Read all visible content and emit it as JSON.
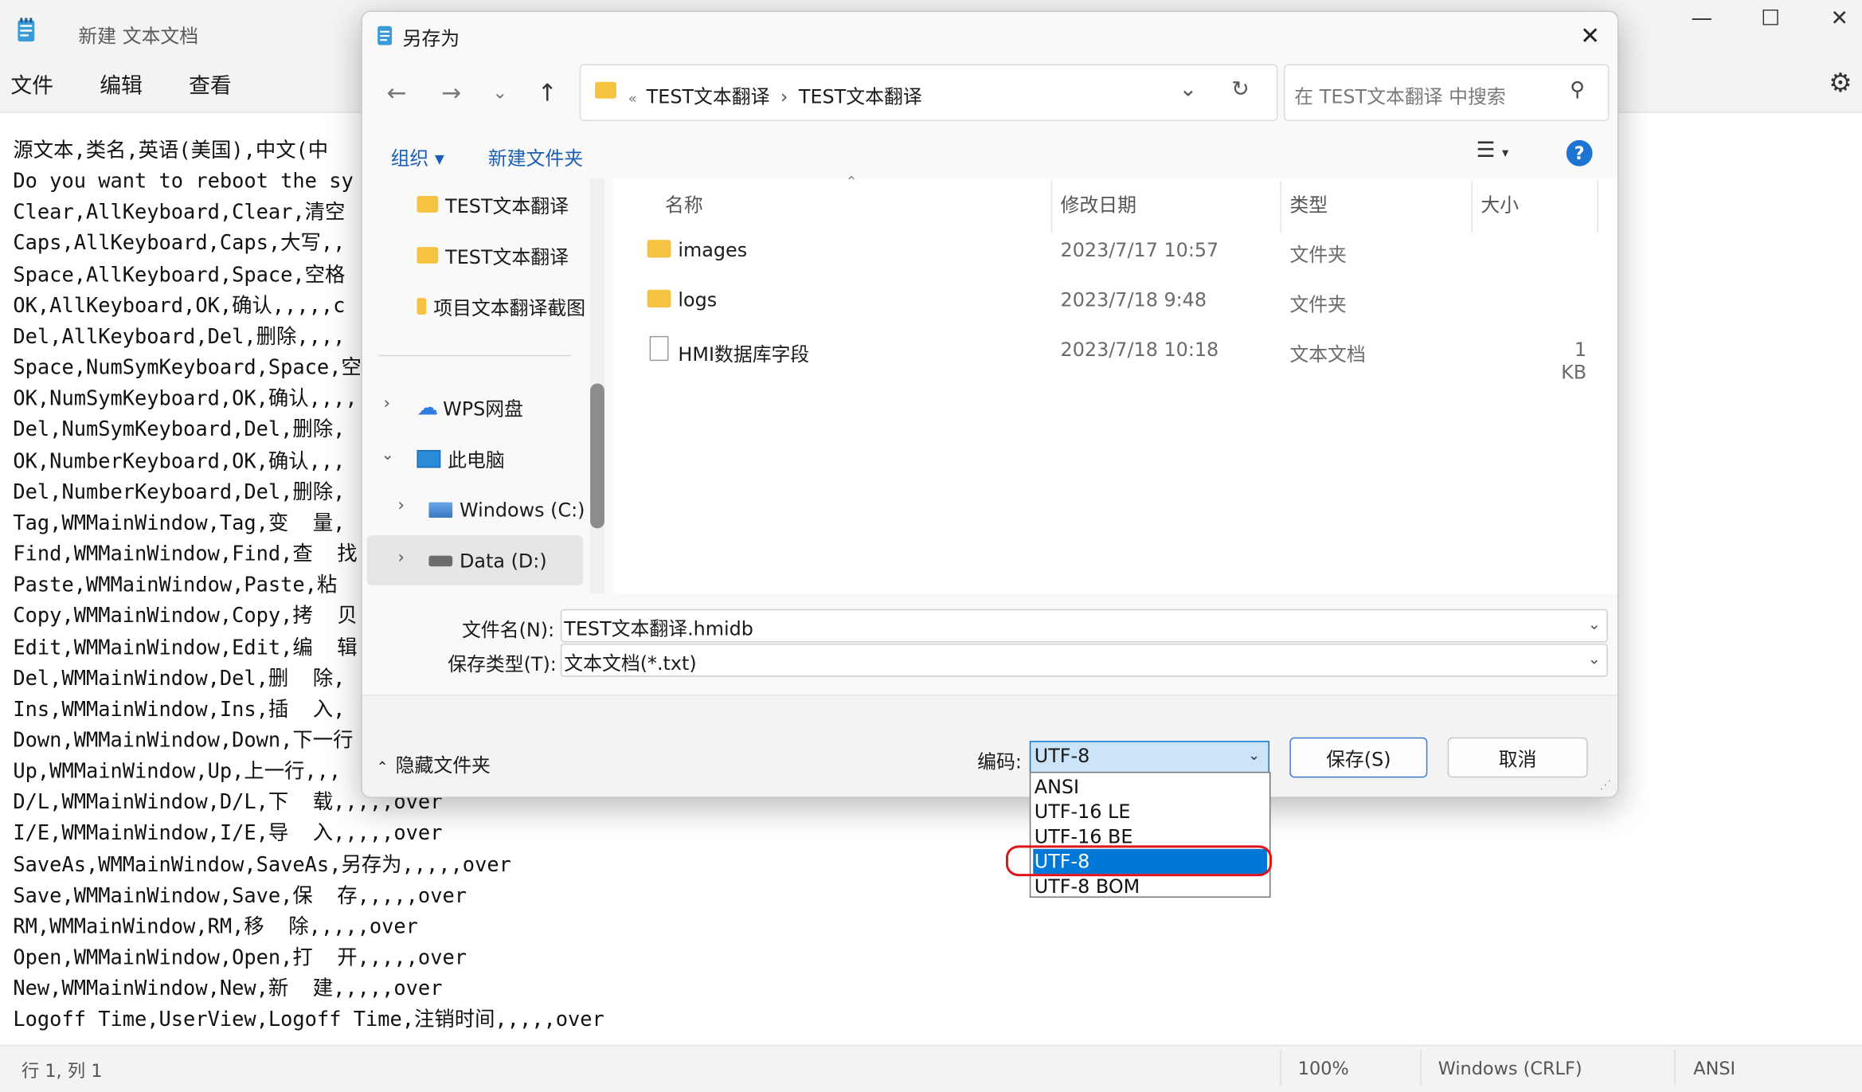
{
  "notepad": {
    "title": "新建 文本文档",
    "menus": [
      "文件",
      "编辑",
      "查看"
    ],
    "lines": [
      "源文本,类名,英语(美国),中文(中",
      "Do you want to reboot the sy",
      "Clear,AllKeyboard,Clear,清空",
      "Caps,AllKeyboard,Caps,大写,,",
      "Space,AllKeyboard,Space,空格",
      "OK,AllKeyboard,OK,确认,,,,,c",
      "Del,AllKeyboard,Del,删除,,,,",
      "Space,NumSymKeyboard,Space,空",
      "OK,NumSymKeyboard,OK,确认,,,,",
      "Del,NumSymKeyboard,Del,删除,",
      "OK,NumberKeyboard,OK,确认,,,",
      "Del,NumberKeyboard,Del,删除,",
      "Tag,WMMainWindow,Tag,变  量,",
      "Find,WMMainWindow,Find,查  找",
      "Paste,WMMainWindow,Paste,粘  ",
      "Copy,WMMainWindow,Copy,拷  贝",
      "Edit,WMMainWindow,Edit,编  辑",
      "Del,WMMainWindow,Del,删  除,",
      "Ins,WMMainWindow,Ins,插  入,",
      "Down,WMMainWindow,Down,下一行",
      "Up,WMMainWindow,Up,上一行,,,",
      "D/L,WMMainWindow,D/L,下  载,,,,,over",
      "I/E,WMMainWindow,I/E,导  入,,,,,over",
      "SaveAs,WMMainWindow,SaveAs,另存为,,,,,over",
      "Save,WMMainWindow,Save,保  存,,,,,over",
      "RM,WMMainWindow,RM,移  除,,,,,over",
      "Open,WMMainWindow,Open,打  开,,,,,over",
      "New,WMMainWindow,New,新  建,,,,,over",
      "Logoff Time,UserView,Logoff Time,注销时间,,,,,over"
    ],
    "status": {
      "position": "行 1, 列 1",
      "zoom": "100%",
      "line_ending": "Windows (CRLF)",
      "encoding": "ANSI"
    }
  },
  "dialog": {
    "title": "另存为",
    "address": {
      "path": [
        "TEST文本翻译",
        "TEST文本翻译"
      ],
      "separator": "›",
      "prefix": "«"
    },
    "search_placeholder": "在 TEST文本翻译 中搜索",
    "commands": {
      "organize": "组织 ▾",
      "new_folder": "新建文件夹"
    },
    "nav": [
      {
        "label": "TEST文本翻译",
        "type": "folder"
      },
      {
        "label": "TEST文本翻译",
        "type": "folder"
      },
      {
        "label": "项目文本翻译截图",
        "type": "folder"
      },
      {
        "label": "WPS网盘",
        "type": "cloud"
      },
      {
        "label": "此电脑",
        "type": "pc"
      },
      {
        "label": "Windows (C:)",
        "type": "drive"
      },
      {
        "label": "Data (D:)",
        "type": "drive"
      }
    ],
    "columns": {
      "name": "名称",
      "date": "修改日期",
      "type": "类型",
      "size": "大小"
    },
    "files": [
      {
        "name": "images",
        "date": "2023/7/17 10:57",
        "type": "文件夹",
        "size": ""
      },
      {
        "name": "logs",
        "date": "2023/7/18 9:48",
        "type": "文件夹",
        "size": ""
      },
      {
        "name": "HMI数据库字段",
        "date": "2023/7/18 10:18",
        "type": "文本文档",
        "size": "1 KB"
      }
    ],
    "filename_label": "文件名(N):",
    "filename_value": "TEST文本翻译.hmidb",
    "filetype_label": "保存类型(T):",
    "filetype_value": "文本文档(*.txt)",
    "hide_folders": "隐藏文件夹",
    "encoding_label": "编码:",
    "encoding_value": "UTF-8",
    "encoding_options": [
      "ANSI",
      "UTF-16 LE",
      "UTF-16 BE",
      "UTF-8",
      "UTF-8 BOM"
    ],
    "encoding_selected_index": 3,
    "save_button": "保存(S)",
    "cancel_button": "取消"
  }
}
